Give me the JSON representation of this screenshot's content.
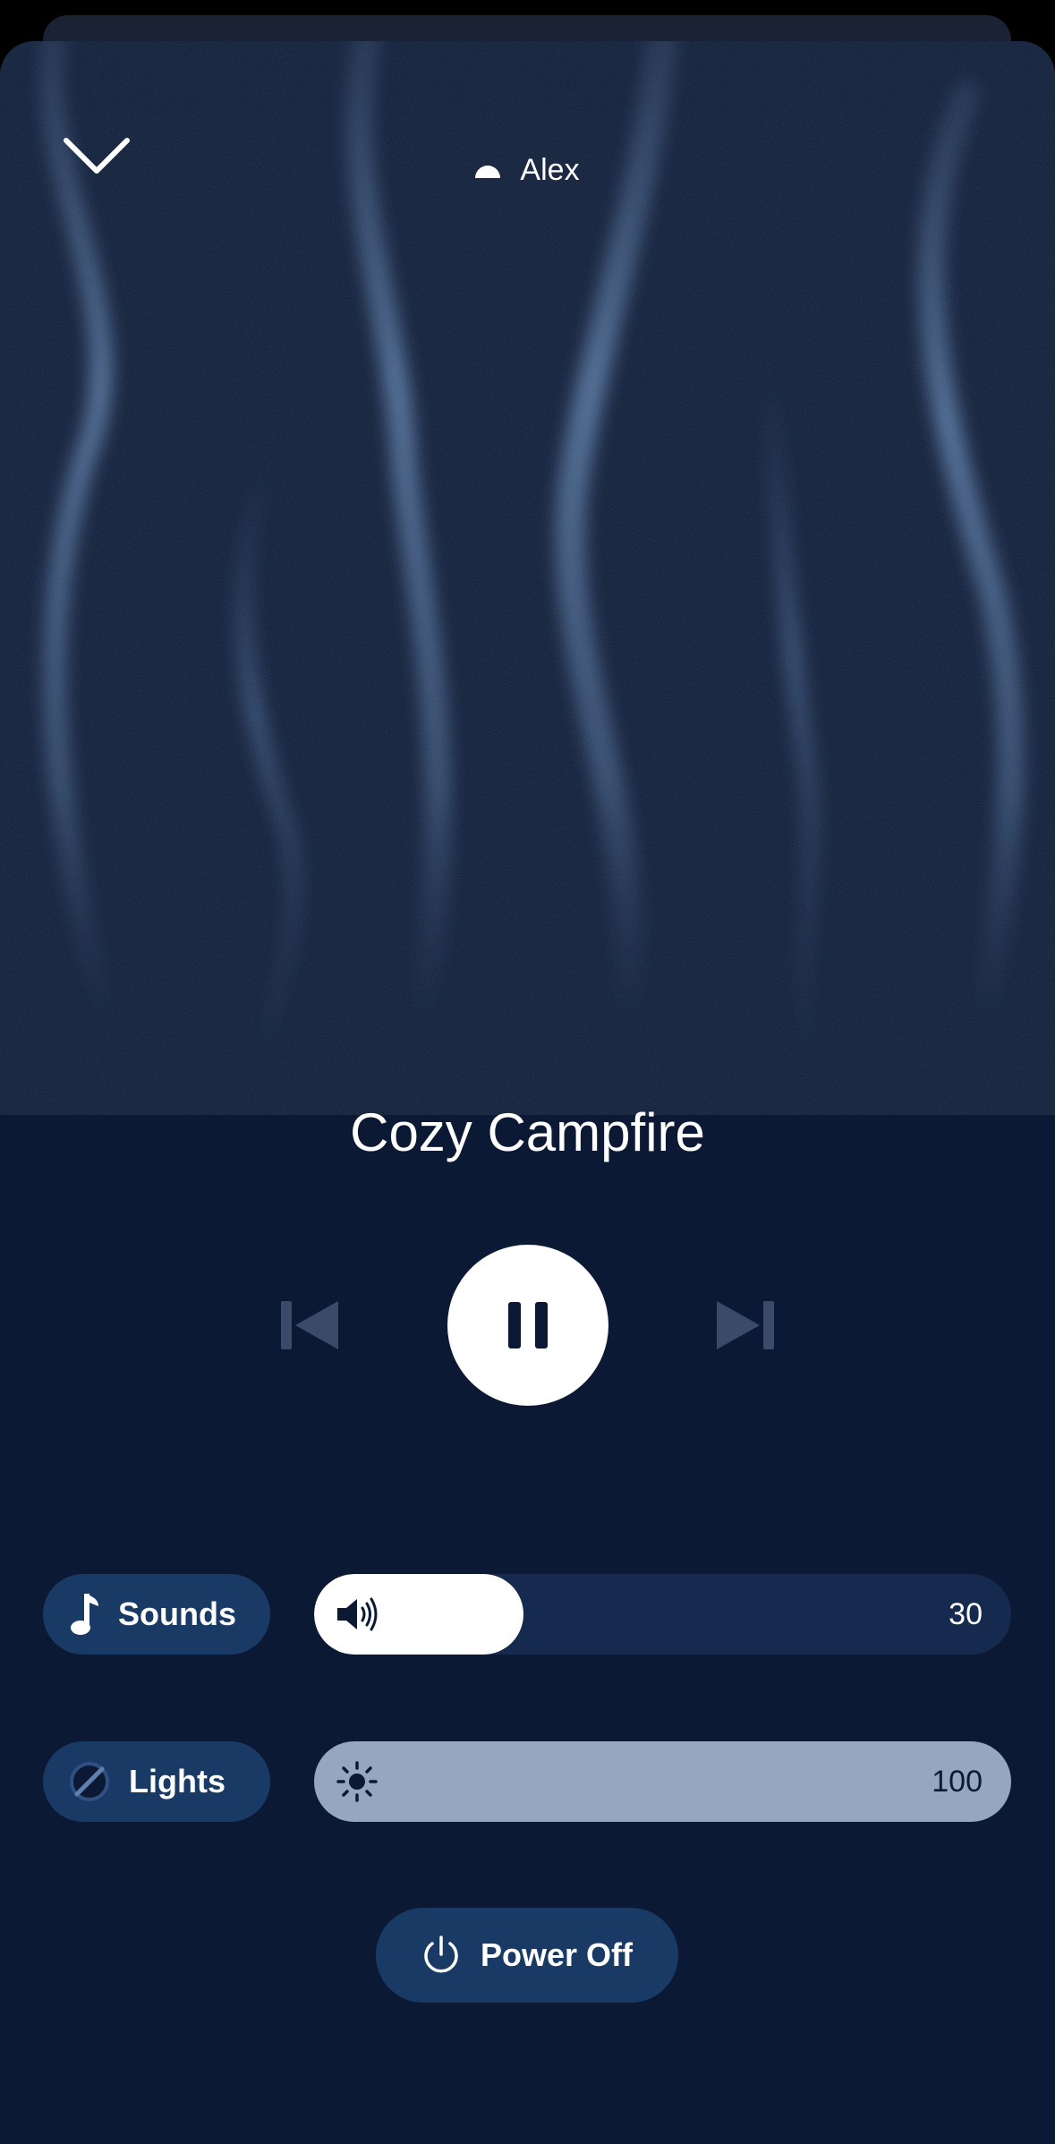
{
  "header": {
    "user_name": "Alex",
    "close_icon": "chevron-down-icon",
    "avatar_icon": "half-circle-icon"
  },
  "player": {
    "track_title": "Cozy Campfire",
    "state": "playing",
    "prev_icon": "skip-previous-icon",
    "pause_icon": "pause-icon",
    "next_icon": "skip-next-icon"
  },
  "controls": {
    "sounds": {
      "label": "Sounds",
      "icon": "music-note-icon",
      "slider_icon": "volume-icon",
      "value": "30",
      "level": 0.3
    },
    "lights": {
      "label": "Lights",
      "icon": "no-color-icon",
      "slider_icon": "brightness-icon",
      "value": "100",
      "level": 1.0
    }
  },
  "power": {
    "label": "Power Off",
    "icon": "power-icon"
  },
  "colors": {
    "background": "#0c1934",
    "pill": "#1a3a66",
    "track": "#152a4e",
    "lights_fill": "#95a6c1",
    "accent": "#ffffff"
  }
}
